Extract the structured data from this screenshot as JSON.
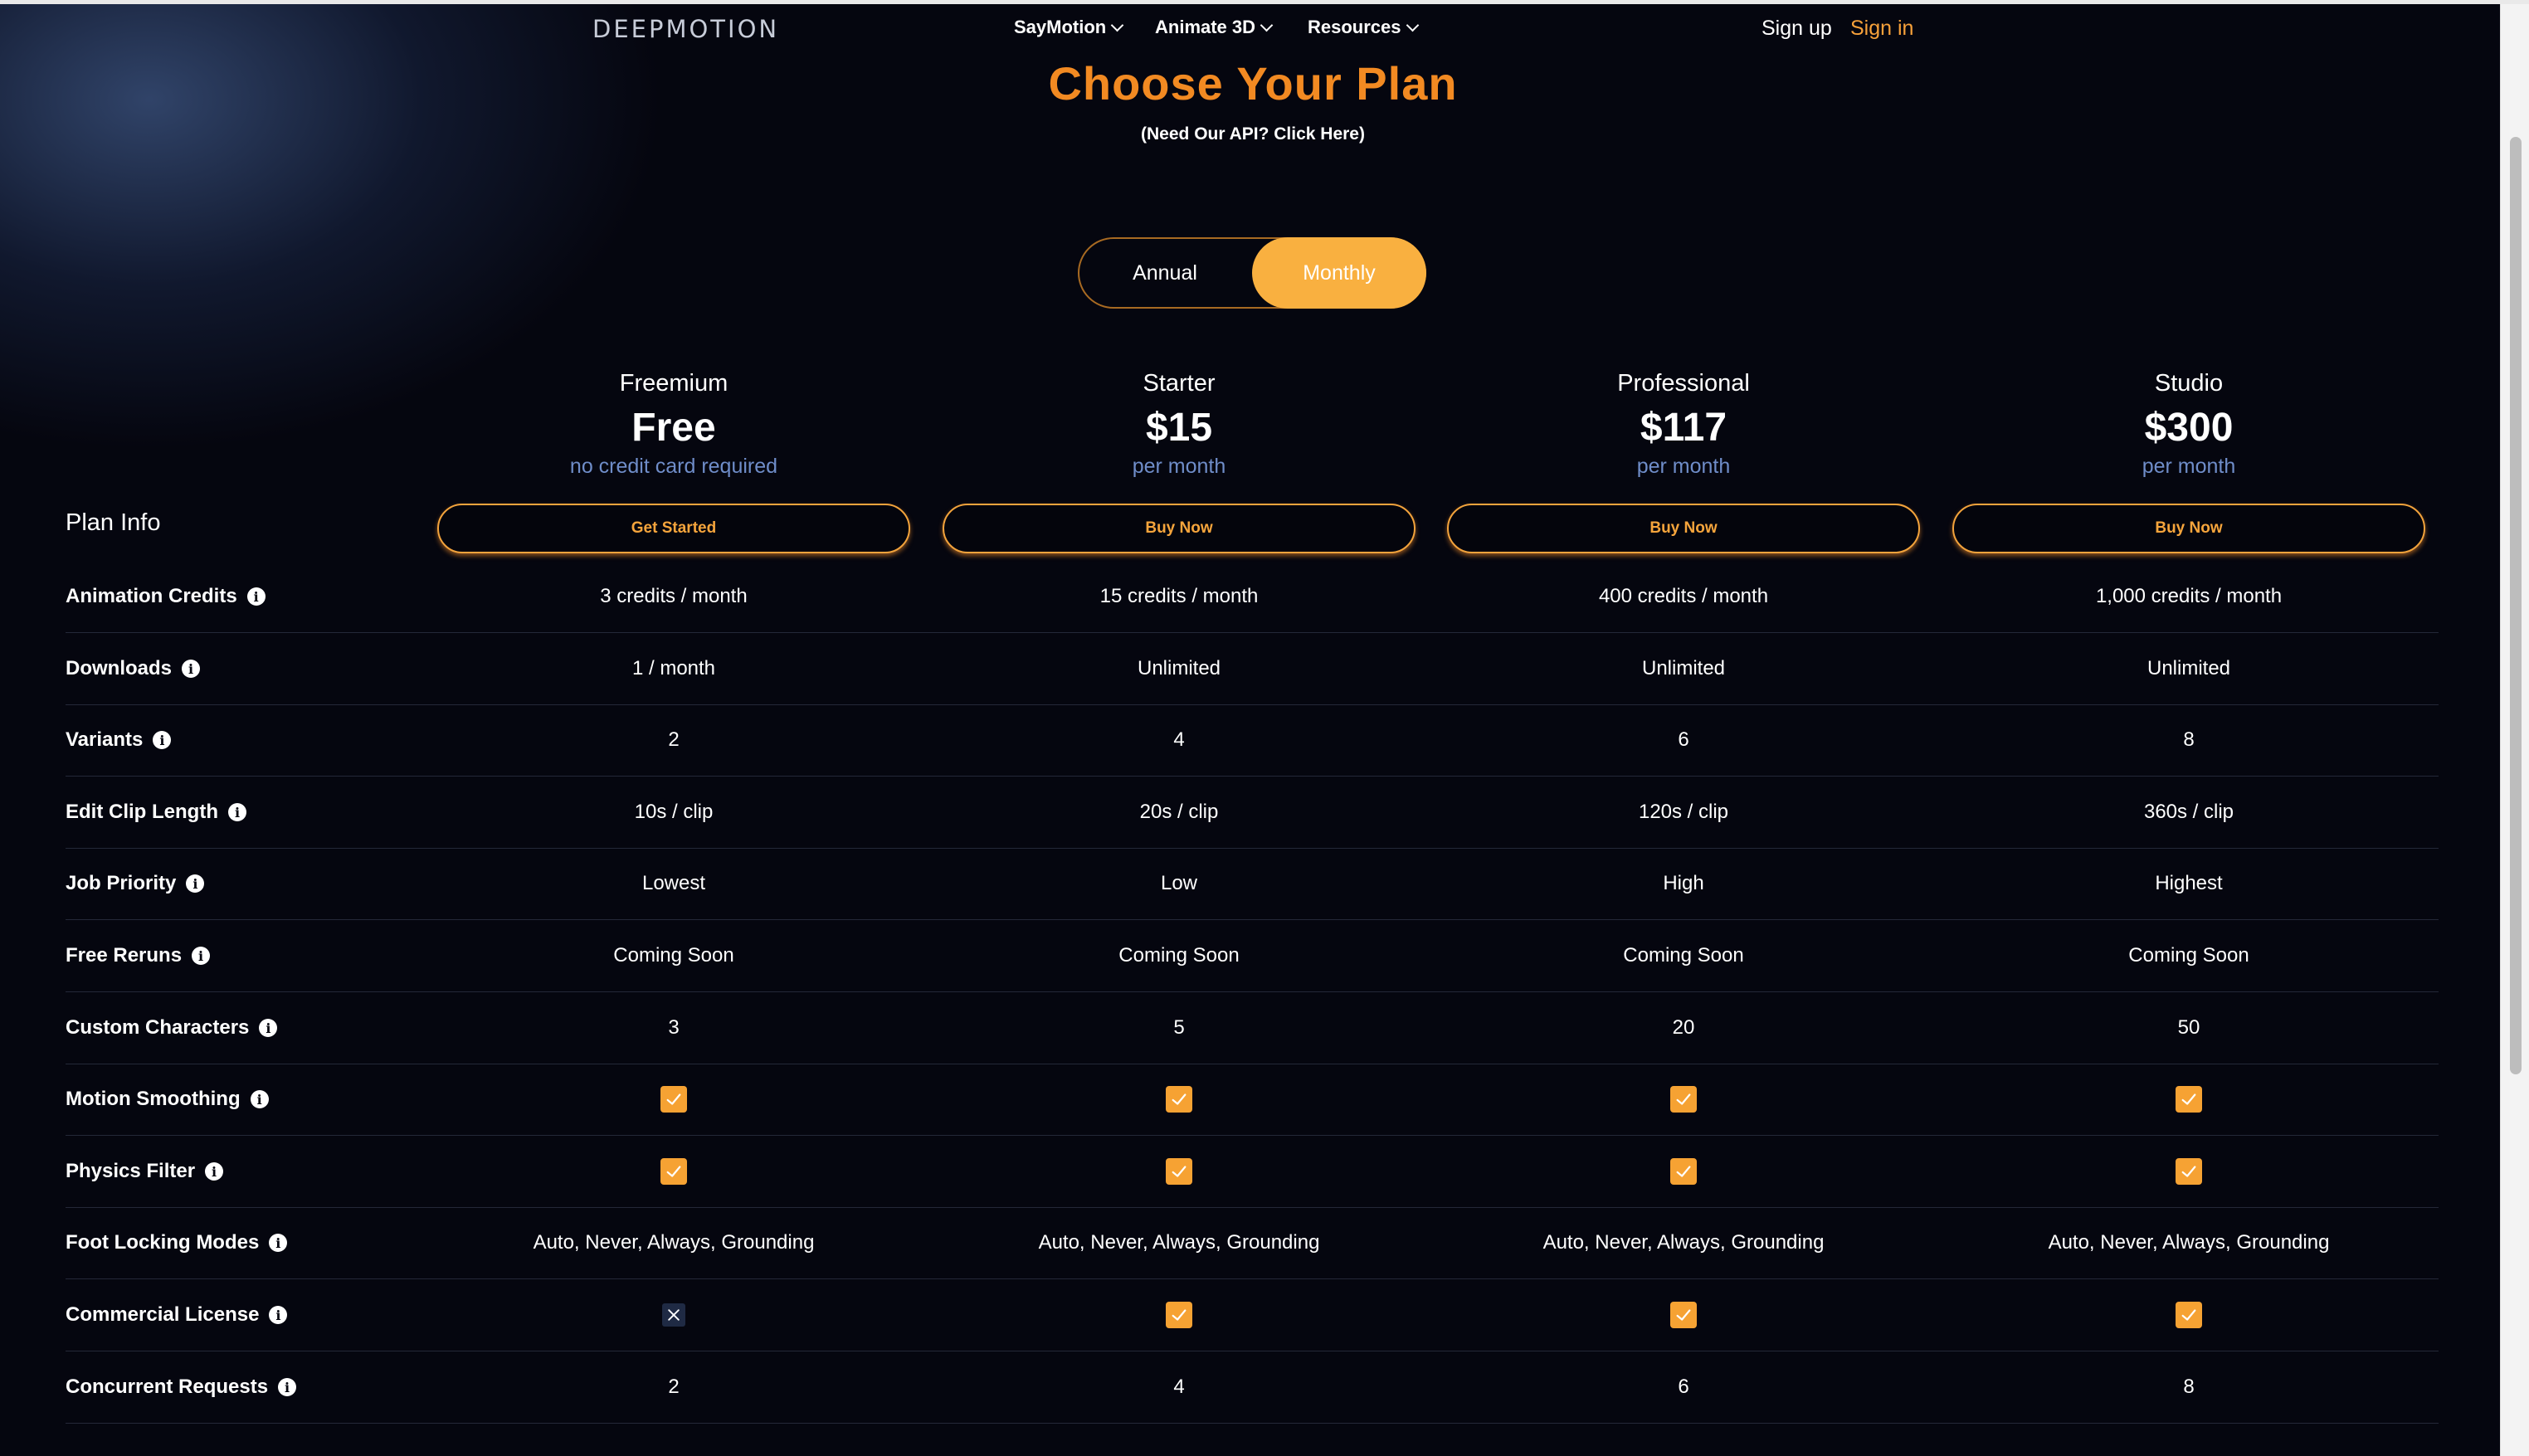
{
  "nav": {
    "logo": "DEEPMOTION",
    "items": [
      "SayMotion",
      "Animate 3D",
      "Resources"
    ],
    "sign_up": "Sign up",
    "sign_in": "Sign in"
  },
  "hero": {
    "title": "Choose Your Plan",
    "api_link": "(Need Our API? Click Here)"
  },
  "billing_toggle": {
    "annual": "Annual",
    "monthly": "Monthly",
    "selected": "Monthly"
  },
  "plan_info_label": "Plan Info",
  "plans": [
    {
      "name": "Freemium",
      "price": "Free",
      "sub": "no credit card required",
      "button": "Get Started"
    },
    {
      "name": "Starter",
      "price": "$15",
      "sub": "per month",
      "button": "Buy Now"
    },
    {
      "name": "Professional",
      "price": "$117",
      "sub": "per month",
      "button": "Buy Now"
    },
    {
      "name": "Studio",
      "price": "$300",
      "sub": "per month",
      "button": "Buy Now"
    }
  ],
  "features": [
    {
      "label": "Animation Credits",
      "values": [
        "3 credits / month",
        "15 credits / month",
        "400 credits / month",
        "1,000 credits / month"
      ]
    },
    {
      "label": "Downloads",
      "values": [
        "1 / month",
        "Unlimited",
        "Unlimited",
        "Unlimited"
      ]
    },
    {
      "label": "Variants",
      "values": [
        "2",
        "4",
        "6",
        "8"
      ]
    },
    {
      "label": "Edit Clip Length",
      "values": [
        "10s / clip",
        "20s / clip",
        "120s / clip",
        "360s / clip"
      ]
    },
    {
      "label": "Job Priority",
      "values": [
        "Lowest",
        "Low",
        "High",
        "Highest"
      ]
    },
    {
      "label": "Free Reruns",
      "values": [
        "Coming Soon",
        "Coming Soon",
        "Coming Soon",
        "Coming Soon"
      ]
    },
    {
      "label": "Custom Characters",
      "values": [
        "3",
        "5",
        "20",
        "50"
      ]
    },
    {
      "label": "Motion Smoothing",
      "values": [
        true,
        true,
        true,
        true
      ]
    },
    {
      "label": "Physics Filter",
      "values": [
        true,
        true,
        true,
        true
      ]
    },
    {
      "label": "Foot Locking Modes",
      "values": [
        "Auto, Never, Always, Grounding",
        "Auto, Never, Always, Grounding",
        "Auto, Never, Always, Grounding",
        "Auto, Never, Always, Grounding"
      ]
    },
    {
      "label": "Commercial License",
      "values": [
        false,
        true,
        true,
        true
      ]
    },
    {
      "label": "Concurrent Requests",
      "values": [
        "2",
        "4",
        "6",
        "8"
      ]
    }
  ],
  "colors": {
    "accent": "#f28a22",
    "button_border": "#f2a33c",
    "toggle_active": "#f9b040",
    "subtext": "#6f8dc9",
    "background": "#05060f"
  }
}
